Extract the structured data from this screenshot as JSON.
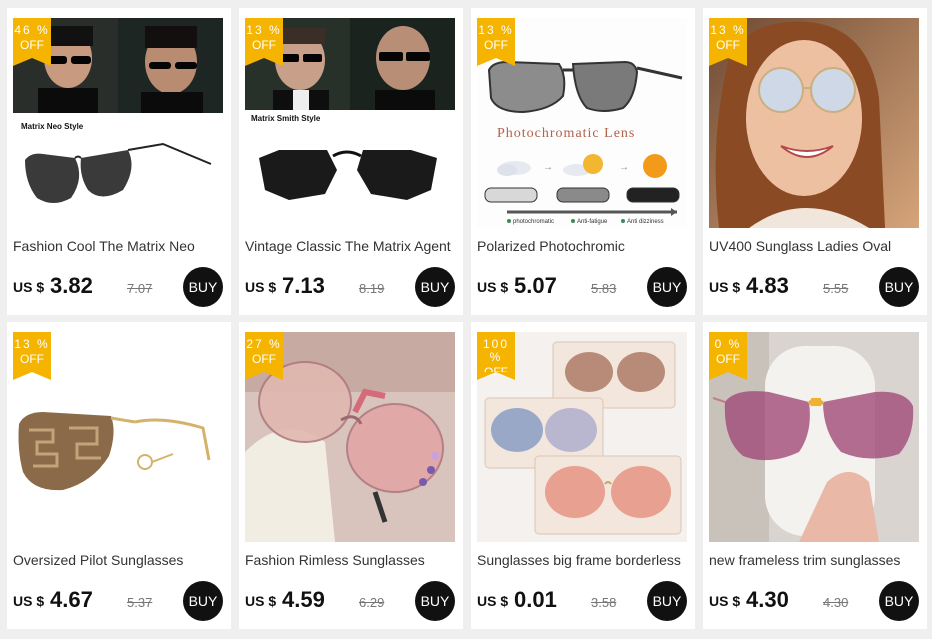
{
  "products": [
    {
      "discount": "46 %",
      "off": "OFF",
      "title": "Fashion Cool The Matrix Neo",
      "currency": "US $",
      "price": "3.82",
      "original": "7.07",
      "buy": "BUY",
      "caption": "Matrix Neo Style"
    },
    {
      "discount": "13 %",
      "off": "OFF",
      "title": "Vintage Classic The Matrix Agent",
      "currency": "US $",
      "price": "7.13",
      "original": "8.19",
      "buy": "BUY",
      "caption": "Matrix Smith Style"
    },
    {
      "discount": "13 %",
      "off": "OFF",
      "title": "Polarized Photochromic",
      "currency": "US $",
      "price": "5.07",
      "original": "5.83",
      "buy": "BUY",
      "caption": "Photochromatic Lens",
      "features": [
        "photochromatic",
        "Anti-fatigue",
        "Anti dizziness"
      ]
    },
    {
      "discount": "13 %",
      "off": "OFF",
      "title": "UV400 Sunglass Ladies Oval",
      "currency": "US $",
      "price": "4.83",
      "original": "5.55",
      "buy": "BUY"
    },
    {
      "discount": "13 %",
      "off": "OFF",
      "title": "Oversized Pilot Sunglasses",
      "currency": "US $",
      "price": "4.67",
      "original": "5.37",
      "buy": "BUY"
    },
    {
      "discount": "27 %",
      "off": "OFF",
      "title": "Fashion Rimless Sunglasses",
      "currency": "US $",
      "price": "4.59",
      "original": "6.29",
      "buy": "BUY"
    },
    {
      "discount": "100 %",
      "off": "OFF",
      "title": "Sunglasses big frame borderless",
      "currency": "US $",
      "price": "0.01",
      "original": "3.58",
      "buy": "BUY"
    },
    {
      "discount": "0 %",
      "off": "OFF",
      "title": "new frameless trim sunglasses",
      "currency": "US $",
      "price": "4.30",
      "original": "4.30",
      "buy": "BUY"
    }
  ],
  "colors": {
    "badge": "#f5b400",
    "buy_button": "#111111",
    "background": "#efefef"
  }
}
